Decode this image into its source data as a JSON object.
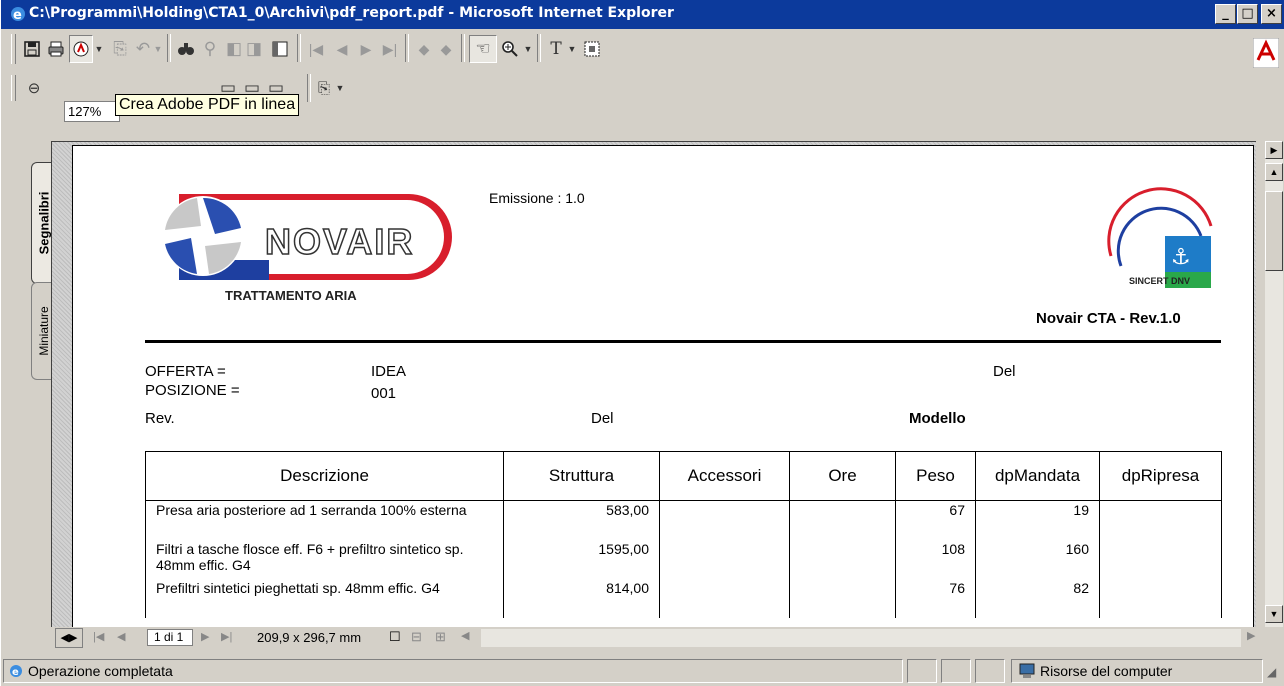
{
  "window": {
    "title": "C:\\Programmi\\Holding\\CTA1_0\\Archivi\\pdf_report.pdf - Microsoft Internet Explorer",
    "minimize": "_",
    "maximize": "□",
    "close": "×"
  },
  "toolbar": {
    "zoom_value": "127%",
    "tooltip": "Crea Adobe PDF in linea"
  },
  "sidebar": {
    "tabs": [
      {
        "label": "Segnalibri"
      },
      {
        "label": "Miniature"
      }
    ]
  },
  "document": {
    "logo_brand": "NOVAIR",
    "logo_sub": "TRATTAMENTO ARIA",
    "emissione": "Emissione : 1.0",
    "cert_text": "SINCERT DNV",
    "version": "Novair CTA - Rev.1.0",
    "offerta_label": "OFFERTA =",
    "offerta_value": "IDEA",
    "del_label_1": "Del",
    "posizione_label": "POSIZIONE =",
    "posizione_value": "001",
    "rev_label": "Rev.",
    "del_label_2": "Del",
    "modello_label": "Modello",
    "table": {
      "columns": [
        "Descrizione",
        "Struttura",
        "Accessori",
        "Ore",
        "Peso",
        "dpMandata",
        "dpRipresa"
      ],
      "rows": [
        {
          "descr": "Presa aria posteriore ad 1 serranda 100% esterna",
          "struttura": "583,00",
          "accessori": "",
          "ore": "",
          "peso": "67",
          "dpmandata": "19",
          "dpripresa": ""
        },
        {
          "descr": "Filtri a tasche flosce eff. F6 + prefiltro sintetico  sp. 48mm effic. G4",
          "struttura": "1595,00",
          "accessori": "",
          "ore": "",
          "peso": "108",
          "dpmandata": "160",
          "dpripresa": ""
        },
        {
          "descr": "Prefiltri sintetici pieghettati sp. 48mm effic. G4",
          "struttura": "814,00",
          "accessori": "",
          "ore": "",
          "peso": "76",
          "dpmandata": "82",
          "dpripresa": ""
        }
      ]
    }
  },
  "bottom_bar": {
    "page_indicator": "1 di 1",
    "page_size": "209,9 x 296,7 mm"
  },
  "statusbar": {
    "status": "Operazione completata",
    "zone": "Risorse del computer"
  }
}
